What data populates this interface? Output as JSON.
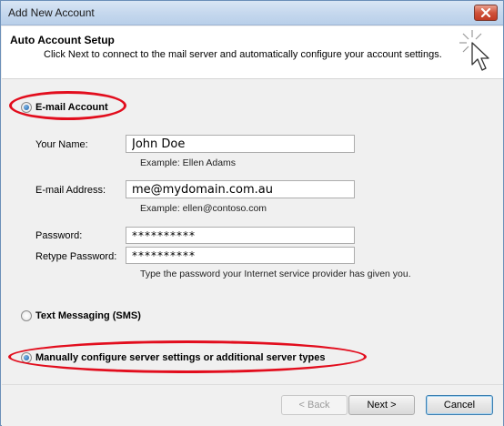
{
  "window": {
    "title": "Add New Account"
  },
  "header": {
    "title": "Auto Account Setup",
    "description": "Click Next to connect to the mail server and automatically configure your account settings."
  },
  "options": {
    "email_account": "E-mail Account",
    "text_messaging": "Text Messaging (SMS)",
    "manual_config": "Manually configure server settings or additional server types"
  },
  "form": {
    "your_name_label": "Your Name:",
    "your_name_value": "John Doe",
    "your_name_hint": "Example: Ellen Adams",
    "email_label": "E-mail Address:",
    "email_value": "me@mydomain.com.au",
    "email_hint": "Example: ellen@contoso.com",
    "password_label": "Password:",
    "password_value": "**********",
    "retype_label": "Retype Password:",
    "retype_value": "**********",
    "password_hint": "Type the password your Internet service provider has given you."
  },
  "buttons": {
    "back": "< Back",
    "next": "Next >",
    "cancel": "Cancel"
  },
  "colors": {
    "annotation": "#e20d1d"
  }
}
